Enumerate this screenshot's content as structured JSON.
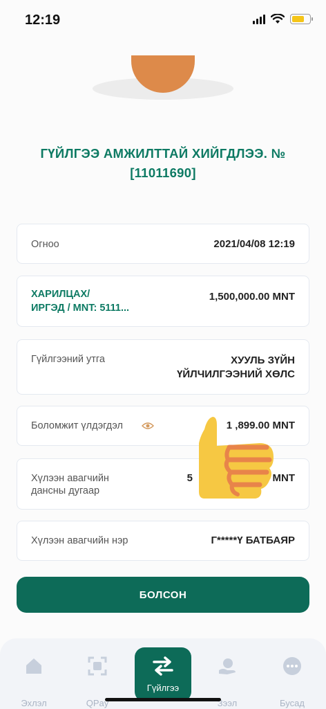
{
  "status_bar": {
    "time": "12:19"
  },
  "hero": {
    "title": "ГҮЙЛГЭЭ АМЖИЛТТАЙ ХИЙГДЛЭЭ. № [11011690]"
  },
  "rows": {
    "date": {
      "label": "Огноо",
      "value": "2021/04/08 12:19"
    },
    "account": {
      "label_line1": "ХАРИЛЦАХ/",
      "label_line2": "ИРГЭД / MNT: 5111...",
      "value": "1,500,000.00 MNT"
    },
    "description": {
      "label": "Гүйлгээний утга",
      "value_line1": "ХУУЛЬ ЗҮЙН",
      "value_line2": "ҮЙЛЧИЛГЭЭНИЙ ХӨЛС"
    },
    "balance": {
      "label": "Боломжит үлдэгдэл",
      "value": "1 ,899.00 MNT"
    },
    "receiver_account": {
      "label_line1": "Хүлээн авагчийн",
      "label_line2": "дансны дугаар",
      "value": "5",
      "value_suffix": "MNT"
    },
    "receiver_name": {
      "label": "Хүлээн авагчийн нэр",
      "value": "Г*****Ү БАТБАЯР"
    }
  },
  "primary_button": {
    "label": "БОЛСОН"
  },
  "tabbar": {
    "items": [
      {
        "label": "Эхлэл",
        "icon": "home-icon"
      },
      {
        "label": "QPay",
        "icon": "qr-scan-icon"
      },
      {
        "label": "Гүйлгээ",
        "icon": "transfer-arrows-icon",
        "active": true
      },
      {
        "label": "Зээл",
        "icon": "loan-hand-icon"
      },
      {
        "label": "Бусад",
        "icon": "more-dots-icon"
      }
    ]
  },
  "colors": {
    "accent": "#0d6b58",
    "title_green": "#0d7a63",
    "inactive_tab": "#aab4c4"
  }
}
